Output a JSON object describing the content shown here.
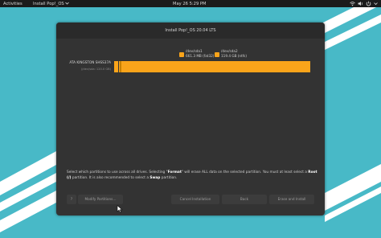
{
  "topbar": {
    "activities": "Activities",
    "app_menu": "Install Pop!_OS",
    "app_menu_icon": "chevron-down-icon",
    "datetime": "May 26    5:29 PM",
    "tray_icons": [
      "network-icon",
      "volume-icon",
      "power-icon",
      "chevron-down-icon"
    ]
  },
  "window": {
    "title": "Install Pop!_OS 20.04 LTS"
  },
  "partitions": [
    {
      "device": "/dev/sda1",
      "size": "661.3 MB (fat32)",
      "color": "#faa41a"
    },
    {
      "device": "/dev/sda2",
      "size": "119.4 GB (ntfs)",
      "color": "#faa41a"
    }
  ],
  "disk": {
    "name": "ATA KINGSTON SHSS37A",
    "info": "(/dev/sda: 120.0 GB)"
  },
  "instructions": {
    "part1": "Select which partitions to use across all drives. Selecting \"",
    "format": "Format",
    "part2": "\" will erase ALL data on the selected partition. You must at least select a ",
    "root": "Root (/)",
    "part3": " partition. It is also recommended to select a ",
    "swap": "Swap",
    "part4": " partition."
  },
  "buttons": {
    "help": "?",
    "modify": "Modify Partitions…",
    "cancel": "Cancel Installation",
    "back": "Back",
    "erase": "Erase and Install"
  },
  "colors": {
    "desktop": "#48b9c7",
    "accent": "#faa41a",
    "window_bg": "#333333"
  }
}
